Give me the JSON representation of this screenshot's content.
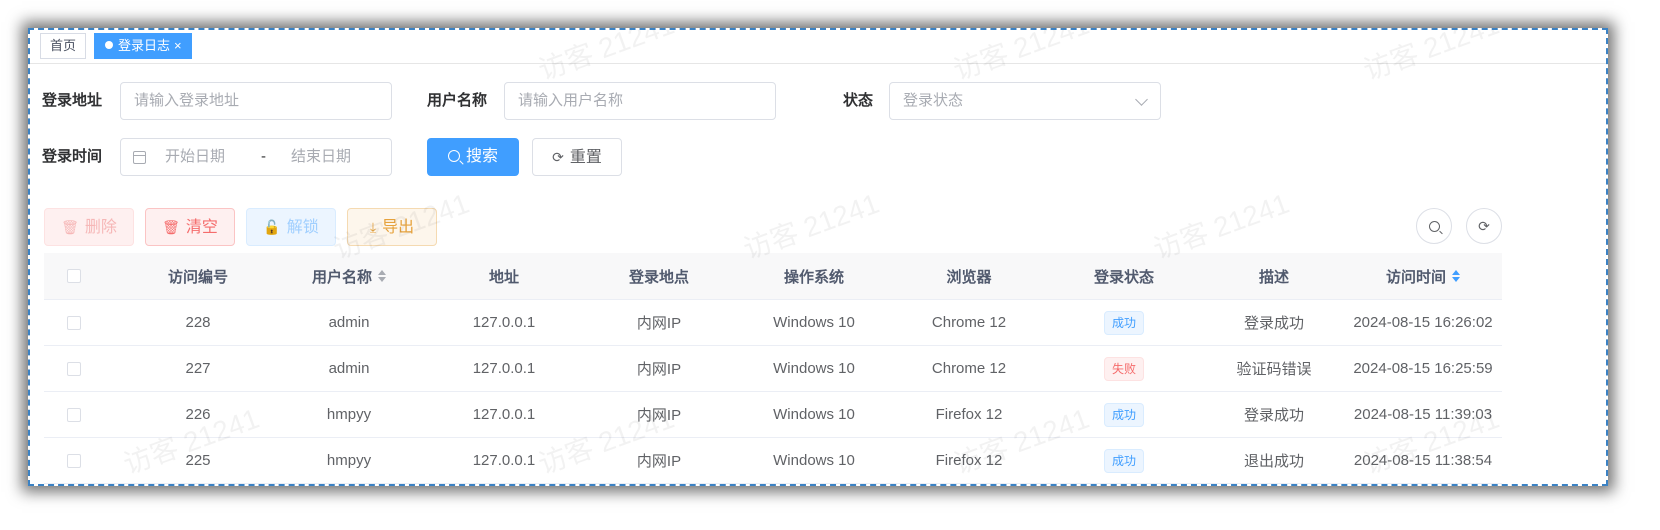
{
  "tags": {
    "home": "首页",
    "active": "登录日志",
    "close": "×"
  },
  "search_form": {
    "ipaddr_label": "登录地址",
    "ipaddr_placeholder": "请输入登录地址",
    "username_label": "用户名称",
    "username_placeholder": "请输入用户名称",
    "status_label": "状态",
    "status_placeholder": "登录状态",
    "time_label": "登录时间",
    "start_placeholder": "开始日期",
    "range_separator": "-",
    "end_placeholder": "结束日期",
    "search_button": "搜索",
    "reset_button": "重置"
  },
  "toolbar": {
    "delete": "删除",
    "clear": "清空",
    "unlock": "解锁",
    "export": "导出"
  },
  "table": {
    "headers": [
      "访问编号",
      "用户名称",
      "地址",
      "登录地点",
      "操作系统",
      "浏览器",
      "登录状态",
      "描述",
      "访问时间"
    ],
    "rows": [
      {
        "id": "228",
        "user": "admin",
        "ip": "127.0.0.1",
        "location": "内网IP",
        "os": "Windows 10",
        "browser": "Chrome 12",
        "status": "成功",
        "status_type": "success",
        "msg": "登录成功",
        "time": "2024-08-15 16:26:02"
      },
      {
        "id": "227",
        "user": "admin",
        "ip": "127.0.0.1",
        "location": "内网IP",
        "os": "Windows 10",
        "browser": "Chrome 12",
        "status": "失败",
        "status_type": "fail",
        "msg": "验证码错误",
        "time": "2024-08-15 16:25:59"
      },
      {
        "id": "226",
        "user": "hmpyy",
        "ip": "127.0.0.1",
        "location": "内网IP",
        "os": "Windows 10",
        "browser": "Firefox 12",
        "status": "成功",
        "status_type": "success",
        "msg": "登录成功",
        "time": "2024-08-15 11:39:03"
      },
      {
        "id": "225",
        "user": "hmpyy",
        "ip": "127.0.0.1",
        "location": "内网IP",
        "os": "Windows 10",
        "browser": "Firefox 12",
        "status": "成功",
        "status_type": "success",
        "msg": "退出成功",
        "time": "2024-08-15 11:38:54"
      }
    ]
  },
  "watermark": "访客 21241",
  "colors": {
    "primary": "#409eff",
    "danger": "#f56c6c",
    "warning": "#e6a23c",
    "frame_dash": "#3b82c4"
  }
}
